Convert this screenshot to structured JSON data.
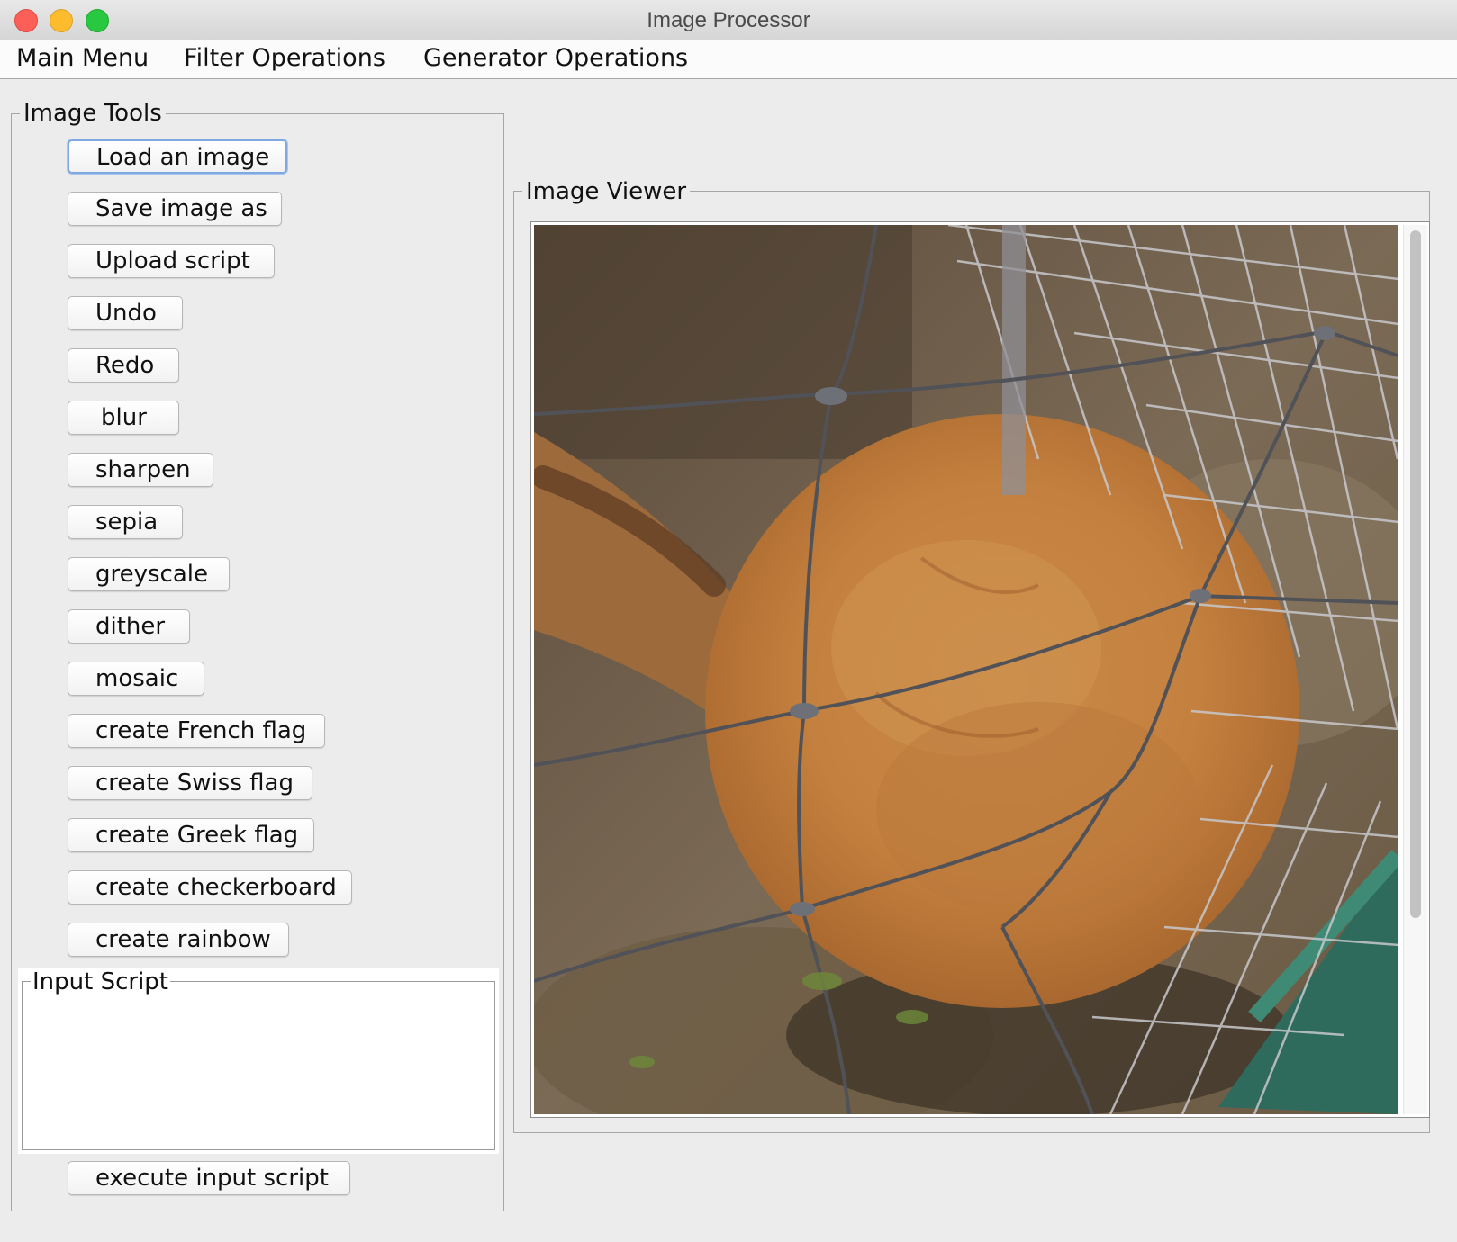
{
  "window": {
    "title": "Image Processor"
  },
  "menu": {
    "items": [
      "Main Menu",
      "Filter Operations",
      "Generator Operations"
    ]
  },
  "image_tools": {
    "label": "Image Tools",
    "buttons": [
      "Load an image",
      "Save image as",
      "Upload script",
      "Undo",
      "Redo",
      "blur",
      "sharpen",
      "sepia",
      "greyscale",
      "dither",
      "mosaic",
      "create French flag",
      "create Swiss flag",
      "create Greek flag",
      "create checkerboard",
      "create rainbow"
    ],
    "focused_button": "Load an image"
  },
  "input_script": {
    "label": "Input Script",
    "value": "",
    "execute_label": "execute input script"
  },
  "image_viewer": {
    "label": "Image Viewer",
    "image_description_icon": "photo-image"
  },
  "colors": {
    "background": "#ececec",
    "focus_ring": "#7fa8e3",
    "close": "#fc5f57",
    "minimize": "#fdbc2e",
    "maximize": "#28c840"
  }
}
